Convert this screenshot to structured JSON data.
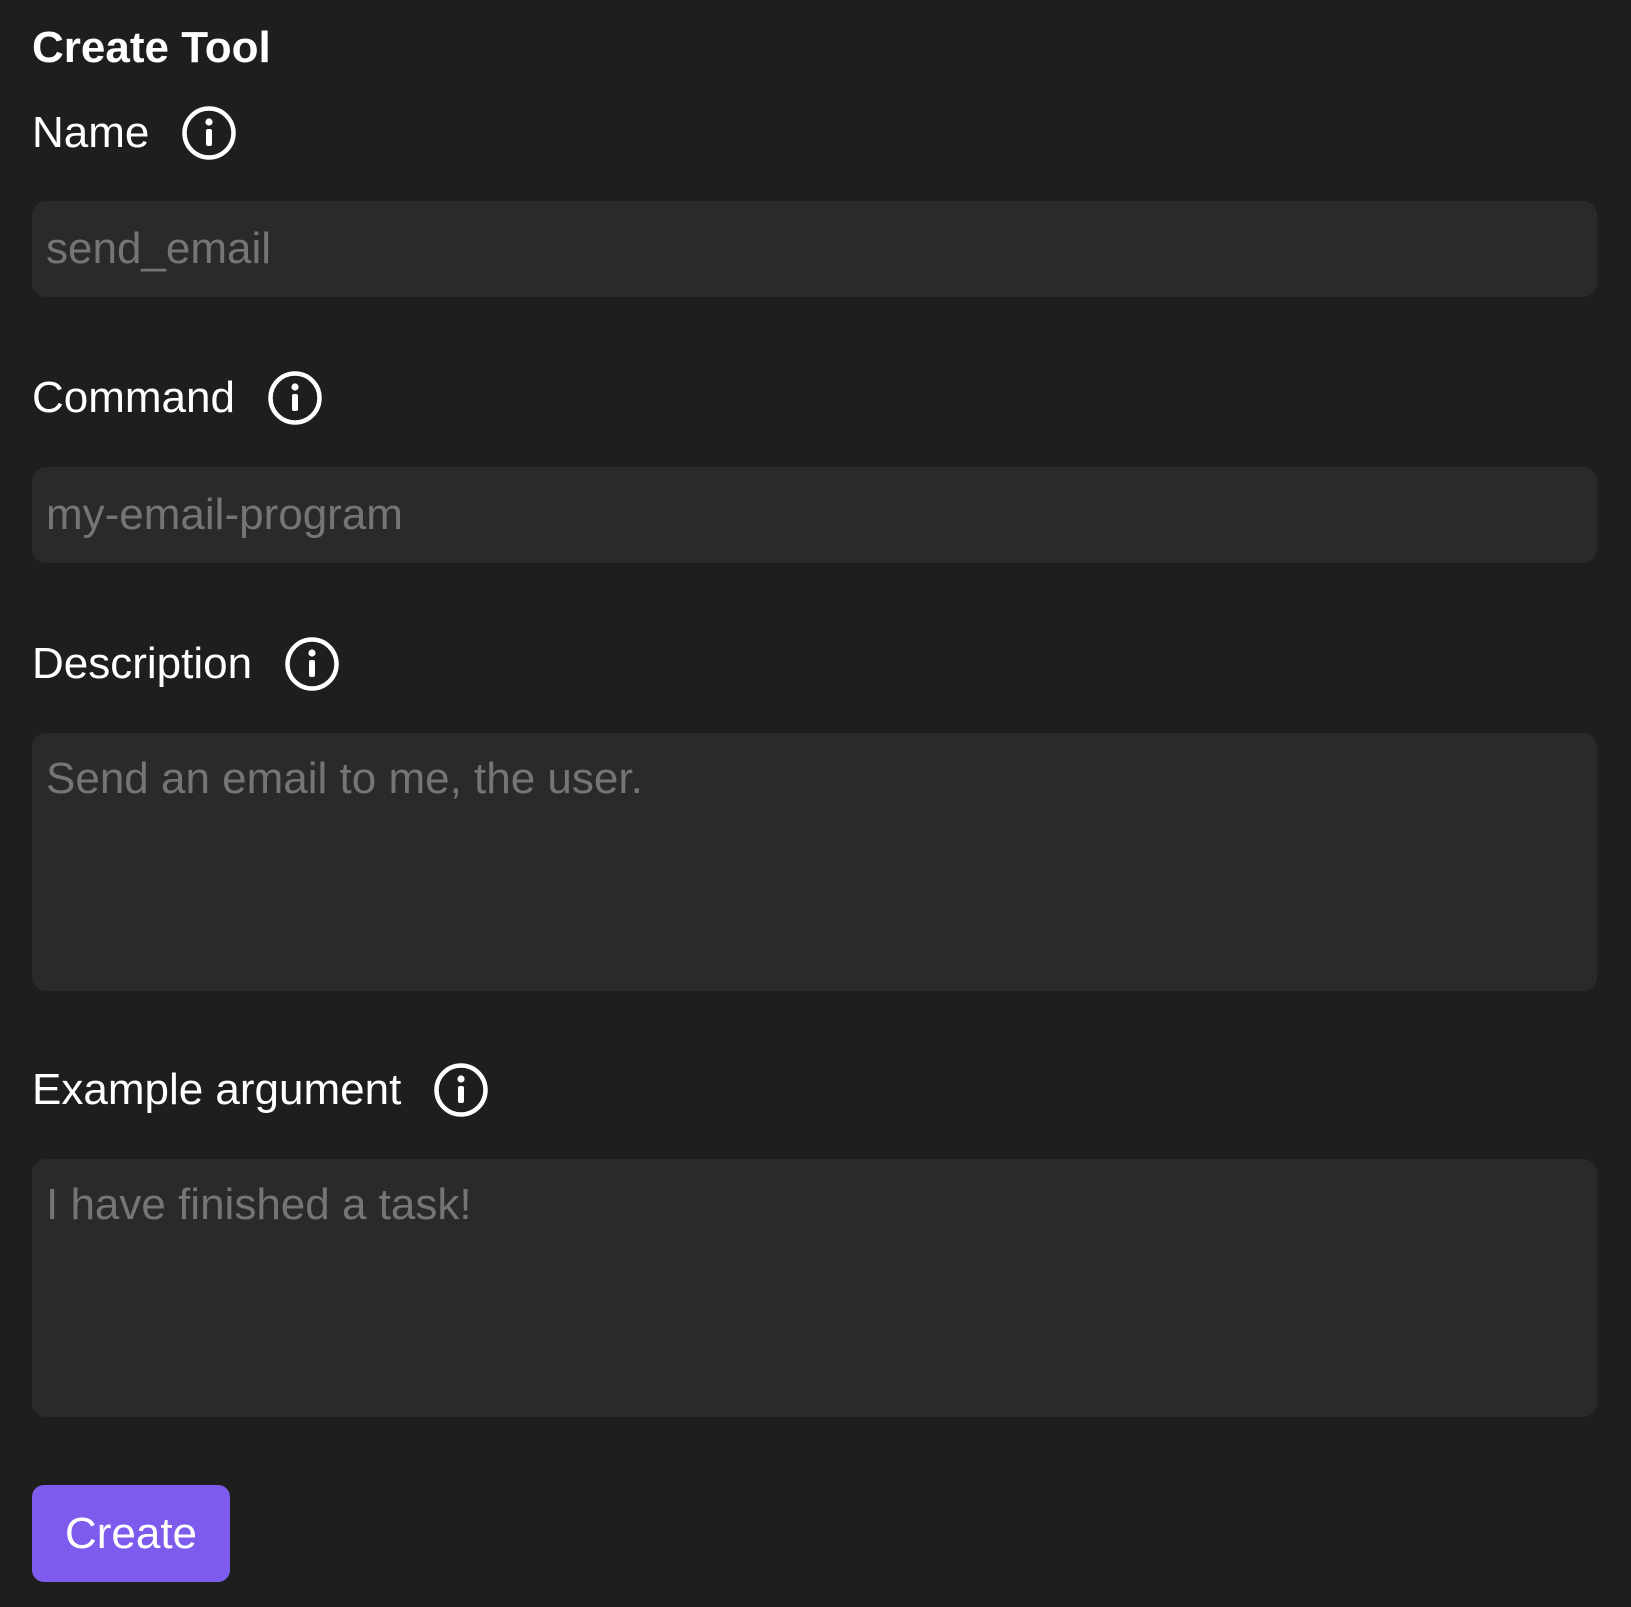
{
  "form": {
    "title": "Create Tool",
    "fields": [
      {
        "label": "Name",
        "icon": "info-icon",
        "placeholder": "send_email",
        "type": "input"
      },
      {
        "label": "Command",
        "icon": "info-icon",
        "placeholder": "my-email-program",
        "type": "input"
      },
      {
        "label": "Description",
        "icon": "info-icon",
        "placeholder": "Send an email to me, the user.",
        "type": "textarea"
      },
      {
        "label": "Example argument",
        "icon": "info-icon",
        "placeholder": "I have finished a task!",
        "type": "textarea"
      }
    ],
    "submit_label": "Create"
  },
  "colors": {
    "background": "#1e1e1e",
    "input_background": "#2a2a2a",
    "placeholder_text": "#9e9e9e",
    "accent": "#7d5bec",
    "text": "#ffffff"
  }
}
